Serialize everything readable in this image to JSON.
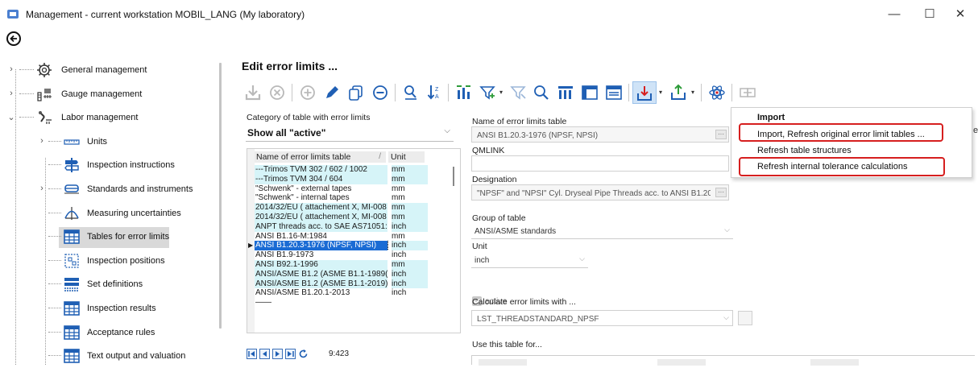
{
  "window": {
    "title": "Management - current workstation MOBIL_LANG (My laboratory)",
    "minimize": "—",
    "maximize": "☐",
    "close": "✕"
  },
  "tree": [
    {
      "label": "General management",
      "icon": "gear-icon",
      "expander": "›",
      "level": 0
    },
    {
      "label": "Gauge management",
      "icon": "gauge-icon",
      "expander": "›",
      "level": 0
    },
    {
      "label": "Labor management",
      "icon": "lab-icon",
      "expander": "⌄",
      "level": 0
    },
    {
      "label": "Units",
      "icon": "ruler-icon",
      "expander": "›",
      "level": 1
    },
    {
      "label": "Inspection instructions",
      "icon": "signpost-icon",
      "expander": "",
      "level": 1
    },
    {
      "label": "Standards and instruments",
      "icon": "instrument-icon",
      "expander": "›",
      "level": 1
    },
    {
      "label": "Measuring uncertainties",
      "icon": "uncertainty-icon",
      "expander": "",
      "level": 1
    },
    {
      "label": "Tables for error limits",
      "icon": "table-icon",
      "expander": "",
      "level": 1
    },
    {
      "label": "Inspection positions",
      "icon": "positions-icon",
      "expander": "",
      "level": 1
    },
    {
      "label": "Set definitions",
      "icon": "set-icon",
      "expander": "",
      "level": 1
    },
    {
      "label": "Inspection results",
      "icon": "table-icon",
      "expander": "",
      "level": 1
    },
    {
      "label": "Acceptance rules",
      "icon": "table-icon",
      "expander": "",
      "level": 1
    },
    {
      "label": "Text output and valuation",
      "icon": "table-icon",
      "expander": "",
      "level": 1
    }
  ],
  "page": {
    "title": "Edit error limits ..."
  },
  "category": {
    "label": "Category of table with error limits",
    "value": "Show all \"active\""
  },
  "grid": {
    "columns": [
      "Name of error limits table",
      "Unit"
    ],
    "rows": [
      [
        "---Trimos TVM 302 / 602 / 1002",
        "mm"
      ],
      [
        "---Trimos TVM 304 / 604",
        "mm"
      ],
      [
        "\"Schwenk\" - external tapes",
        "mm"
      ],
      [
        "\"Schwenk\" - internal tapes",
        "mm"
      ],
      [
        "2014/32/EU ( attachement X, MI-008",
        "mm"
      ],
      [
        "2014/32/EU ( attachement X, MI-008",
        "mm"
      ],
      [
        "ANPT threads acc. to SAE AS71051:",
        "inch"
      ],
      [
        "ANSI B1.16-M:1984",
        "mm"
      ],
      [
        "ANSI B1.20.3-1976 (NPSF, NPSI)",
        "inch"
      ],
      [
        "ANSI B1.9-1973",
        "inch"
      ],
      [
        "ANSI B92.1-1996",
        "mm"
      ],
      [
        "ANSI/ASME B1.2 (ASME B1.1-1989(R",
        "inch"
      ],
      [
        "ANSI/ASME B1.2 (ASME B1.1-2019)",
        "inch"
      ],
      [
        "ANSI/ASME B1.20.1-2013",
        "inch"
      ],
      [
        "——",
        ""
      ]
    ],
    "selected_index": 8,
    "navigator_count": "9:423"
  },
  "form": {
    "name_label": "Name of error limits table",
    "name_value": "ANSI B1.20.3-1976 (NPSF, NPSI)",
    "qmlink_label": "QMLINK",
    "qmlink_value": "",
    "designation_label": "Designation",
    "designation_value": "\"NPSF\" and \"NPSI\" Cyl. Dryseal Pipe Threads acc. to ANSI B1.20.3-",
    "group_label": "Group of table",
    "group_value": "ANSI/ASME standards",
    "unit_label": "Unit",
    "unit_value": "inch",
    "active_label": "active",
    "calc_label": "Calculate error limits with ...",
    "calc_value": "LST_THREADSTANDARD_NPSF",
    "use_label": "Use this table for...",
    "dots": "···",
    "chevron": "⌵"
  },
  "menu": {
    "header": "Import",
    "items": [
      "Import, Refresh original error limit tables ...",
      "Refresh table structures",
      "Refresh internal tolerance calculations"
    ],
    "edge_letter": "e"
  },
  "colors": {
    "accent": "#1a6bd4",
    "grid_cyan": "#d6f4f8",
    "highlight_red": "#d61f1f",
    "toolbar_blue": "#1f5fb4"
  }
}
